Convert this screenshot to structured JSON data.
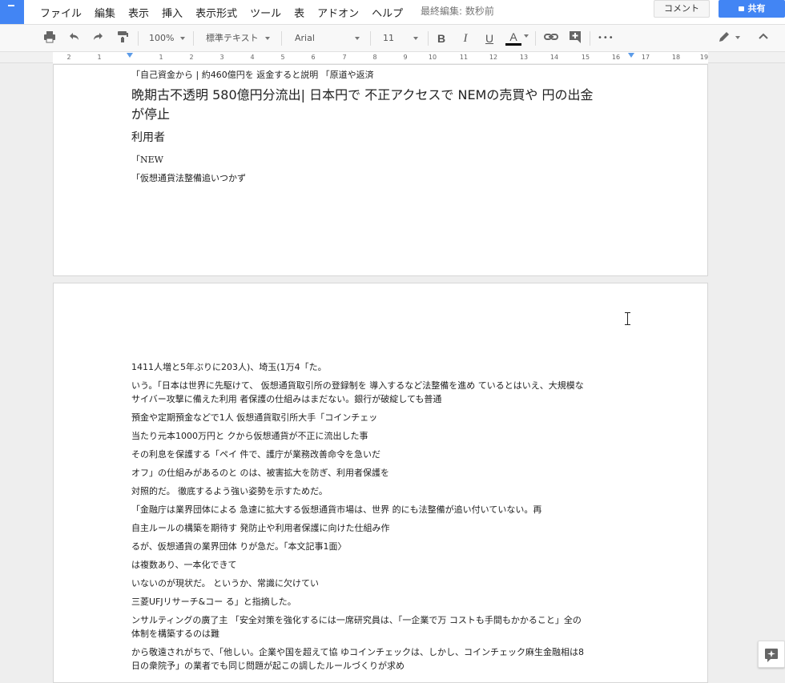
{
  "menu": {
    "items": [
      "ファイル",
      "編集",
      "表示",
      "挿入",
      "表示形式",
      "ツール",
      "表",
      "アドオン",
      "ヘルプ"
    ],
    "last_edit": "最終編集: 数秒前"
  },
  "header_buttons": {
    "comment": "コメント",
    "share": "共有"
  },
  "toolbar": {
    "zoom": "100%",
    "style": "標準テキスト",
    "font": "Arial",
    "font_size": "11",
    "bold": "B",
    "italic": "I",
    "underline": "U",
    "text_color": "A",
    "more": "•••"
  },
  "ruler": {
    "ticks": [
      "2",
      "1",
      "",
      "1",
      "2",
      "3",
      "4",
      "5",
      "6",
      "7",
      "8",
      "9",
      "10",
      "11",
      "12",
      "13",
      "14",
      "15",
      "16",
      "17",
      "18",
      "19"
    ]
  },
  "page1": {
    "lines": [
      "「自己資金から | 約460億円を 返金すると説明 「原道や返済",
      "晩期古不透明 580億円分流出| 日本円で 不正アクセスで NEMの売買や 円の出金",
      "が停止",
      "利用者",
      "「NEW",
      "「仮想通貨法整備追いつかず"
    ]
  },
  "page2": {
    "lines": [
      "1411人増と5年ぶりに203人)、埼玉(1万4「た。",
      "いう。「日本は世界に先駆けて、 仮想通貨取引所の登録制を 導入するなど法整備を進め ているとはいえ、大規模な",
      "サイバー攻撃に備えた利用 者保護の仕組みはまだない。銀行が破綻しても普通",
      "預金や定期預金などで1人 仮想通貨取引所大手「コインチェッ",
      "当たり元本1000万円と クから仮想通貨が不正に流出した事",
      "その利息を保護する「ペイ 件で、護庁が業務改善命令を急いだ",
      "オフ」の仕組みがあるのと のは、被害拡大を防ぎ、利用者保護を",
      "対照的だ。 徹底するよう強い姿勢を示すためだ。",
      "「金融庁は業界団体による 急速に拡大する仮想通貨市場は、世界 的にも法整備が追い付いていない。再",
      "自主ルールの構築を期待す 発防止や利用者保護に向けた仕組み作",
      "るが、仮想通貨の業界団体 りが急だ。「本文記事1面〉",
      "は複数あり、一本化できて",
      "いないのが現状だ。 というか、常識に欠けてい",
      "三菱UFJリサーチ&コー る」と指摘した。",
      "ンサルティングの廣了主 「安全対策を強化するには一席研究員は、「一企業で万 コストも手間もかかること」全の",
      "体制を構築するのは難",
      "から敬遠されがちで、「他しい。企業や国を超えて協 ゆコインチェックは、しかし、コインチェック麻生金融相は8",
      "日の衆院予」の業者でも同じ問題が起この調したルールづくりが求め"
    ]
  },
  "colors": {
    "brand": "#4285f4",
    "text": "#222222",
    "background": "#eeeeee"
  }
}
